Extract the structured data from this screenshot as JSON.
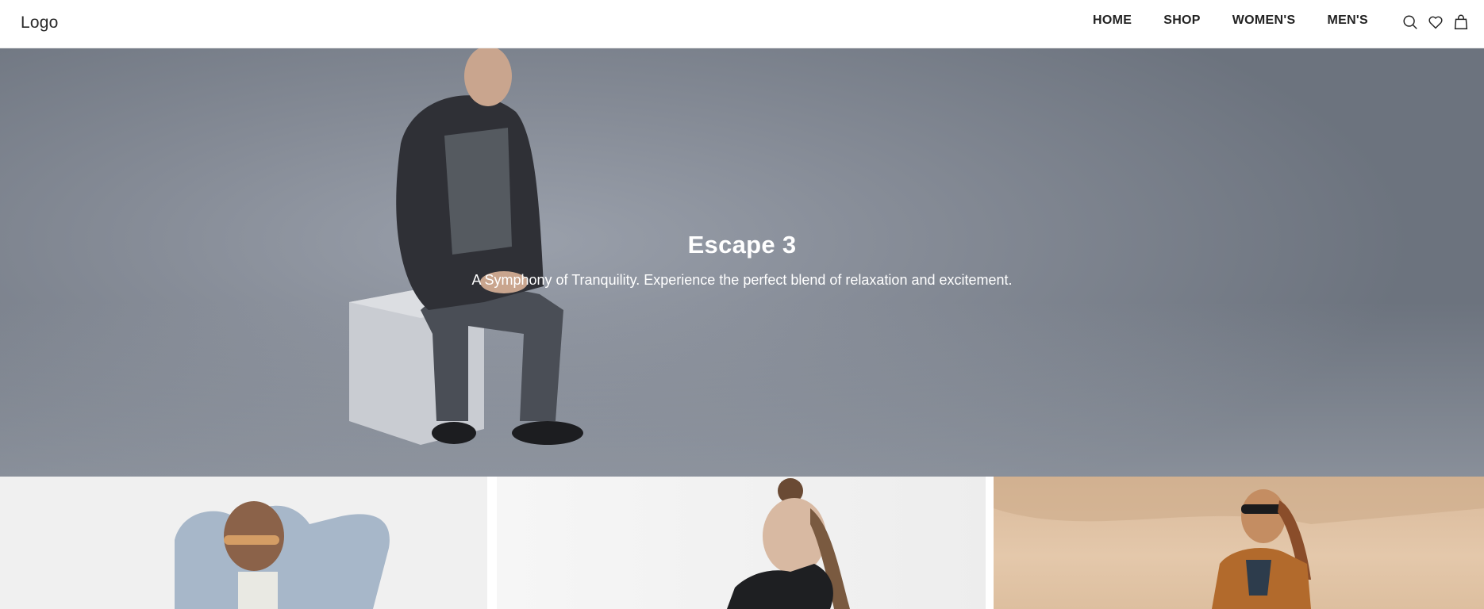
{
  "header": {
    "logo": "Logo",
    "nav": [
      "HOME",
      "SHOP",
      "WOMEN'S",
      "MEN'S"
    ],
    "icons": [
      "search-icon",
      "heart-icon",
      "shopping-bag-icon"
    ]
  },
  "hero": {
    "title": "Escape 3",
    "subtitle": "A Symphony of Tranquility. Experience the perfect blend of relaxation and excitement."
  },
  "colors": {
    "hero_bg": "#858b96",
    "nav_text": "#222222",
    "hero_text": "#ffffff"
  }
}
